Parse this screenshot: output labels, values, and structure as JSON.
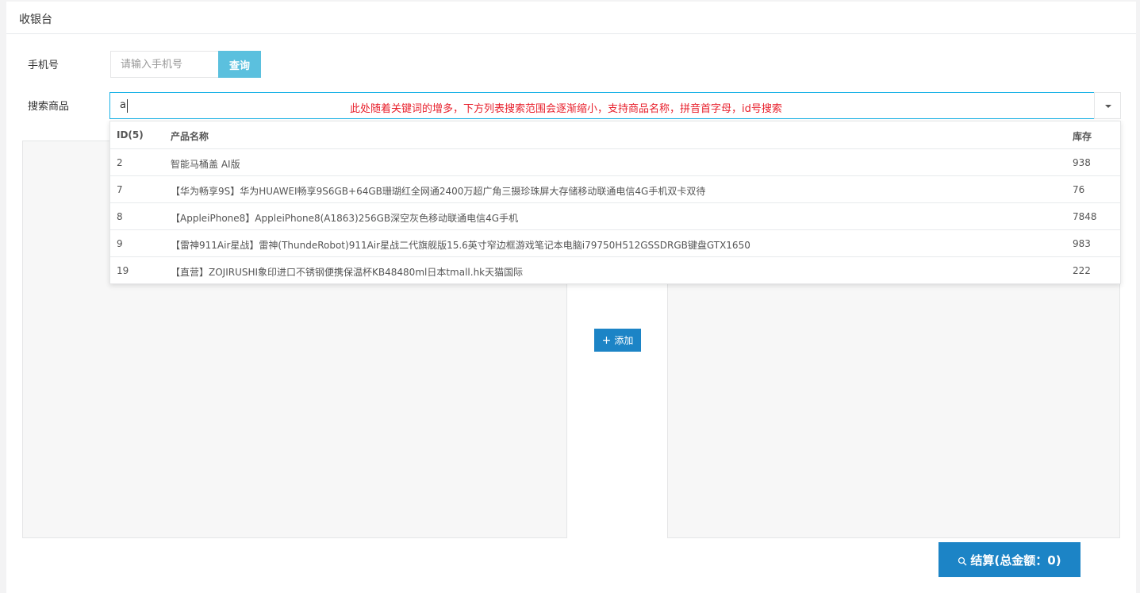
{
  "panel": {
    "title": "收银台"
  },
  "phone": {
    "label": "手机号",
    "placeholder": "请输入手机号",
    "query_label": "查询"
  },
  "search": {
    "label": "搜索商品",
    "value": "a",
    "annotation": "此处随着关键词的增多，下方列表搜索范围会逐渐缩小，支持商品名称，拼音首字母，id号搜索"
  },
  "dropdown": {
    "headers": {
      "id": "ID(5)",
      "name": "产品名称",
      "stock": "库存"
    },
    "rows": [
      {
        "id": "2",
        "name": "智能马桶盖 AI版",
        "stock": "938"
      },
      {
        "id": "7",
        "name": "【华为畅享9S】华为HUAWEI畅享9S6GB+64GB珊瑚红全网通2400万超广角三摄珍珠屏大存储移动联通电信4G手机双卡双待",
        "stock": "76"
      },
      {
        "id": "8",
        "name": "【AppleiPhone8】AppleiPhone8(A1863)256GB深空灰色移动联通电信4G手机",
        "stock": "7848"
      },
      {
        "id": "9",
        "name": "【雷神911Air星战】雷神(ThundeRobot)911Air星战二代旗舰版15.6英寸窄边框游戏笔记本电脑i79750H512GSSDRGB键盘GTX1650",
        "stock": "983"
      },
      {
        "id": "19",
        "name": "【直营】ZOJIRUSHI象印进口不锈钢便携保温杯KB48480ml日本tmall.hk天猫国际",
        "stock": "222"
      }
    ]
  },
  "add_button": {
    "label": "添加",
    "icon": "plus-icon"
  },
  "settle_button": {
    "label": "结算(总金额：0)",
    "icon": "search-icon"
  },
  "colors": {
    "primary": "#1c84c6",
    "info": "#5bc0de",
    "annotation": "#e8202c",
    "focus_border": "#1ab2e6"
  }
}
